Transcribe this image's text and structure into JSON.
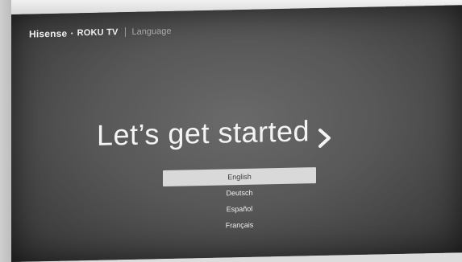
{
  "header": {
    "brand_primary": "Hisense",
    "brand_separator": "·",
    "brand_secondary": "ROKU TV",
    "section_title": "Language"
  },
  "main": {
    "headline": "Let’s get started"
  },
  "languages": {
    "items": [
      {
        "label": "English",
        "selected": true
      },
      {
        "label": "Deutsch",
        "selected": false
      },
      {
        "label": "Español",
        "selected": false
      },
      {
        "label": "Français",
        "selected": false
      }
    ]
  },
  "icons": {
    "forward": "chevron-right-icon"
  }
}
